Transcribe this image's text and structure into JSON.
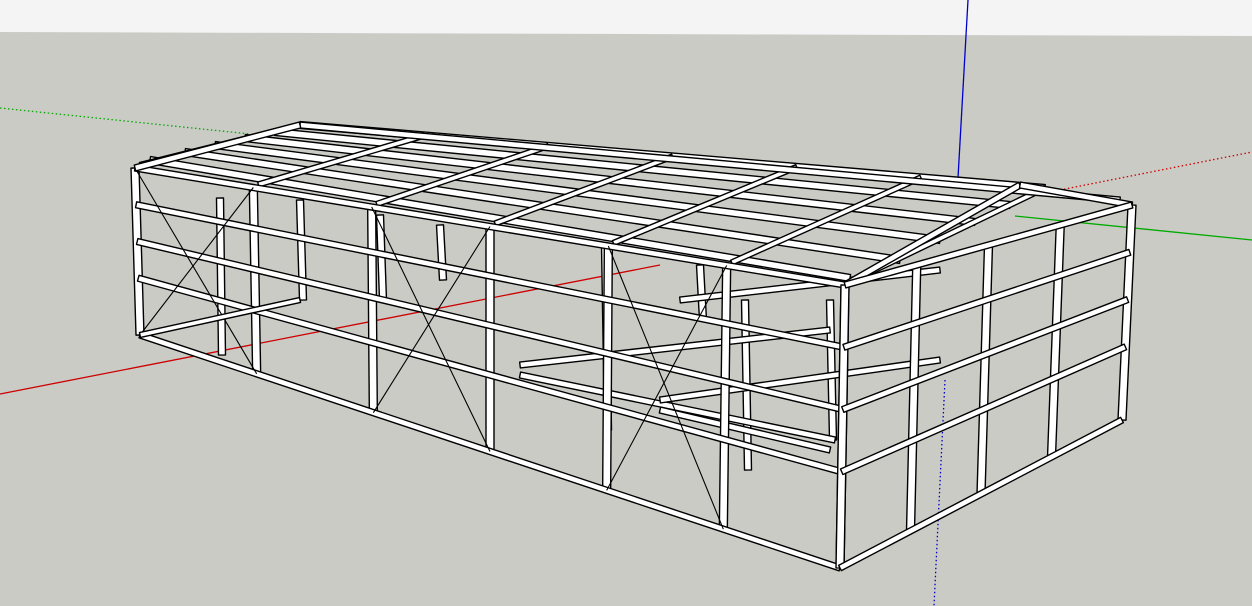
{
  "app": {
    "type": "3d-modeling-viewport"
  },
  "colors": {
    "sky": "#f4f4f4",
    "ground": "#cbcbc6",
    "red_axis": "#cc0000",
    "green_axis": "#00aa00",
    "blue_axis": "#0000cc",
    "steel_edge": "#000000",
    "steel_face": "#ffffff",
    "steel_shade": "#c8c8c8"
  },
  "scene": {
    "model": "steel-frame-building",
    "style": "hidden-line",
    "axes": [
      "red-axis",
      "green-axis",
      "blue-axis"
    ]
  }
}
